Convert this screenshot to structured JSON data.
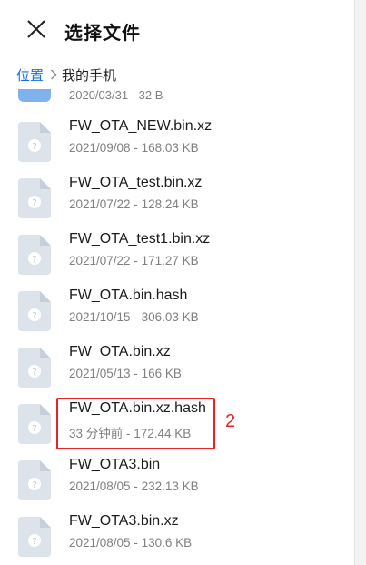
{
  "header": {
    "title": "选择文件",
    "close_icon": "close-icon"
  },
  "breadcrumb": {
    "root": "位置",
    "current": "我的手机"
  },
  "partial_item": {
    "meta": "2020/03/31 - 32 B"
  },
  "files": [
    {
      "name": "FW_OTA_NEW.bin.xz",
      "meta": "2021/09/08 - 168.03 KB"
    },
    {
      "name": "FW_OTA_test.bin.xz",
      "meta": "2021/07/22 - 128.24 KB"
    },
    {
      "name": "FW_OTA_test1.bin.xz",
      "meta": "2021/07/22 - 171.27 KB"
    },
    {
      "name": "FW_OTA.bin.hash",
      "meta": "2021/10/15 - 306.03 KB"
    },
    {
      "name": "FW_OTA.bin.xz",
      "meta": "2021/05/13 - 166 KB"
    },
    {
      "name": "FW_OTA.bin.xz.hash",
      "meta": "33 分钟前 - 172.44 KB"
    },
    {
      "name": "FW_OTA3.bin",
      "meta": "2021/08/05 - 232.13 KB"
    },
    {
      "name": "FW_OTA3.bin.xz",
      "meta": "2021/08/05 - 130.6 KB"
    }
  ],
  "annotation": {
    "label": "2",
    "color": "#e8232a"
  },
  "colors": {
    "accent": "#1a6fe0",
    "file_icon": "#dde3ea",
    "folder": "#7fb2ea"
  }
}
